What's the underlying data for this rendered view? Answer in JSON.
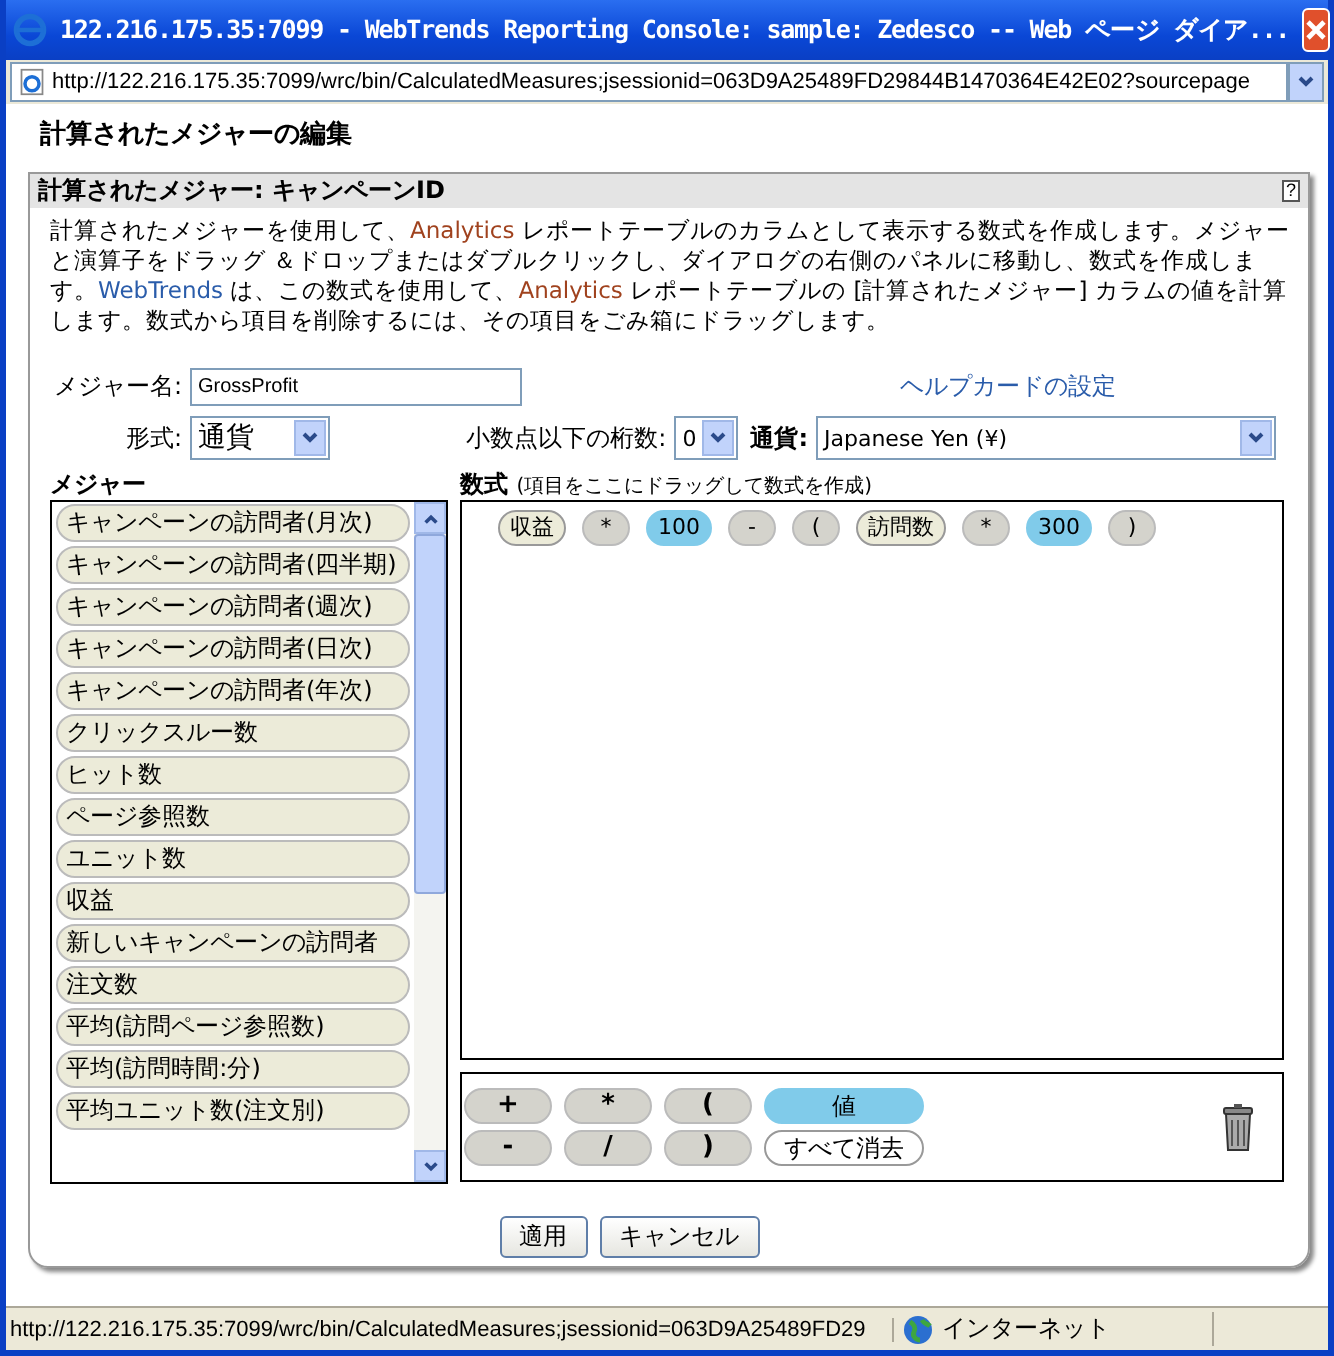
{
  "window": {
    "title": "122.216.175.35:7099 - WebTrends Reporting Console: sample: Zedesco -- Web ページ ダイア..."
  },
  "address_bar": {
    "url": "http://122.216.175.35:7099/wrc/bin/CalculatedMeasures;jsessionid=063D9A25489FD29844B1470364E42E02?sourcepage"
  },
  "page_title": "計算されたメジャーの編集",
  "panel": {
    "title": "計算されたメジャー: キャンペーンID",
    "help": "?",
    "description": [
      {
        "text": "計算されたメジャーを使用して、",
        "kind": "plain"
      },
      {
        "text": "Analytics",
        "kind": "brand"
      },
      {
        "text": " レポートテーブルのカラムとして表示する数式を作成します。メジャーと演算子をドラッグ ＆ドロップまたはダブルクリックし、ダイアログの右側のパネルに移動し、数式を作成します。",
        "kind": "plain"
      },
      {
        "text": "WebTrends",
        "kind": "link"
      },
      {
        "text": " は、この数式を使用して、",
        "kind": "plain"
      },
      {
        "text": "Analytics",
        "kind": "brand"
      },
      {
        "text": " レポートテーブルの [計算されたメジャー] カラムの値を計算します。数式から項目を削除するには、その項目をごみ箱にドラッグします。",
        "kind": "plain"
      }
    ],
    "name_label": "メジャー名:",
    "name_value": "GrossProfit",
    "help_card_link": "ヘルプカードの設定",
    "format_label": "形式:",
    "format_value": "通貨",
    "decimals_label": "小数点以下の桁数:",
    "decimals_value": "0",
    "currency_label": "通貨:",
    "currency_value": "Japanese Yen (¥)",
    "measures_heading": "メジャー",
    "measures": [
      "キャンペーンの訪問者(月次)",
      "キャンペーンの訪問者(四半期)",
      "キャンペーンの訪問者(週次)",
      "キャンペーンの訪問者(日次)",
      "キャンペーンの訪問者(年次)",
      "クリックスルー数",
      "ヒット数",
      "ページ参照数",
      "ユニット数",
      "収益",
      "新しいキャンペーンの訪問者",
      "注文数",
      "平均(訪問ページ参照数)",
      "平均(訪問時間:分)",
      "平均ユニット数(注文別)"
    ],
    "formula_heading": "数式",
    "formula_hint": "(項目をここにドラッグして数式を作成)",
    "formula": [
      {
        "text": "収益",
        "kind": "measure"
      },
      {
        "text": "*",
        "kind": "operator"
      },
      {
        "text": "100",
        "kind": "value"
      },
      {
        "text": "-",
        "kind": "operator"
      },
      {
        "text": "(",
        "kind": "operator"
      },
      {
        "text": "訪問数",
        "kind": "measure"
      },
      {
        "text": "*",
        "kind": "operator"
      },
      {
        "text": "300",
        "kind": "value"
      },
      {
        "text": ")",
        "kind": "operator"
      }
    ],
    "operator_buttons": [
      {
        "text": "+",
        "kind": "operator"
      },
      {
        "text": "*",
        "kind": "operator"
      },
      {
        "text": "(",
        "kind": "operator"
      },
      {
        "text": "値",
        "kind": "value"
      },
      {
        "text": "-",
        "kind": "operator"
      },
      {
        "text": "/",
        "kind": "operator"
      },
      {
        "text": ")",
        "kind": "operator"
      },
      {
        "text": "すべて消去",
        "kind": "clear"
      }
    ],
    "buttons": [
      "適用",
      "キャンセル"
    ]
  },
  "status_bar": {
    "url": "http://122.216.175.35:7099/wrc/bin/CalculatedMeasures;jsessionid=063D9A25489FD29",
    "zone": "インターネット"
  }
}
